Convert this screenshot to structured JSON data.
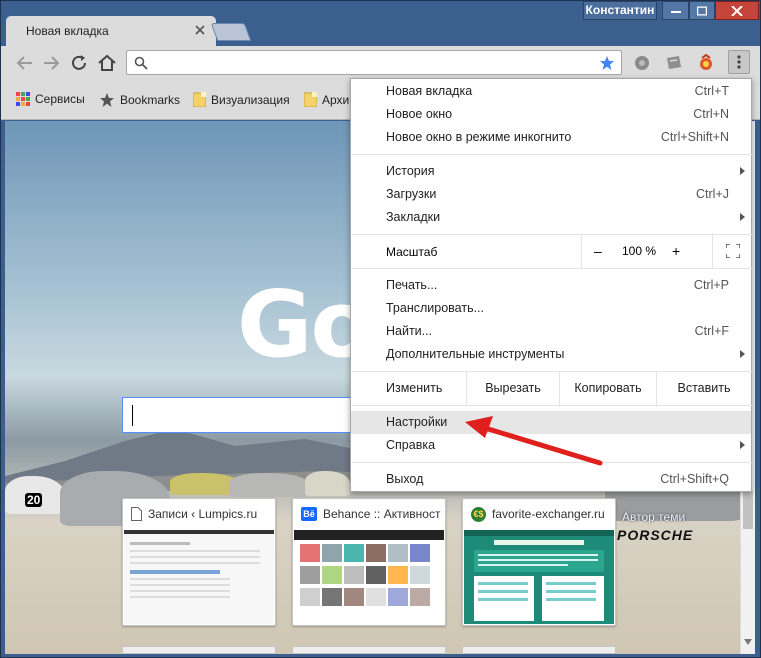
{
  "window": {
    "profile_name": "Константин"
  },
  "tab": {
    "title": "Новая вкладка"
  },
  "bookmarks": [
    {
      "label": "Сервисы",
      "icon": "apps-grid-icon"
    },
    {
      "label": "Bookmarks",
      "icon": "star-icon"
    },
    {
      "label": "Визуализация",
      "icon": "folder-icon"
    },
    {
      "label": "Архи",
      "icon": "folder-icon"
    }
  ],
  "newtab": {
    "logo_text": "Go",
    "author_text": "Автор теми",
    "brand_text": "PORSCHE"
  },
  "thumbnails": [
    {
      "title": "Записи ‹ Lumpics.ru",
      "icon": "document-icon"
    },
    {
      "title": "Behance :: Активност",
      "icon": "behance-icon"
    },
    {
      "title": "favorite-exchanger.ru",
      "icon": "exchanger-icon"
    }
  ],
  "menu": {
    "group1": [
      {
        "label": "Новая вкладка",
        "shortcut": "Ctrl+T"
      },
      {
        "label": "Новое окно",
        "shortcut": "Ctrl+N"
      },
      {
        "label": "Новое окно в режиме инкогнито",
        "shortcut": "Ctrl+Shift+N"
      }
    ],
    "group2": [
      {
        "label": "История",
        "shortcut": ""
      },
      {
        "label": "Загрузки",
        "shortcut": "Ctrl+J"
      },
      {
        "label": "Закладки",
        "shortcut": ""
      }
    ],
    "zoom": {
      "label": "Масштаб",
      "minus": "–",
      "value": "100 %",
      "plus": "+"
    },
    "group3": [
      {
        "label": "Печать...",
        "shortcut": "Ctrl+P"
      },
      {
        "label": "Транслировать...",
        "shortcut": ""
      },
      {
        "label": "Найти...",
        "shortcut": "Ctrl+F"
      },
      {
        "label": "Дополнительные инструменты",
        "shortcut": ""
      }
    ],
    "edit": {
      "label": "Изменить",
      "cut": "Вырезать",
      "copy": "Копировать",
      "paste": "Вставить"
    },
    "settings": {
      "label": "Настройки"
    },
    "help": {
      "label": "Справка"
    },
    "exit": {
      "label": "Выход",
      "shortcut": "Ctrl+Shift+Q"
    }
  },
  "colors": {
    "frame": "#3b5f8f",
    "toolbar": "#dcdcdc",
    "highlight": "#e6e6e6",
    "annotation_arrow": "#e0201c",
    "star": "#4285f4"
  }
}
